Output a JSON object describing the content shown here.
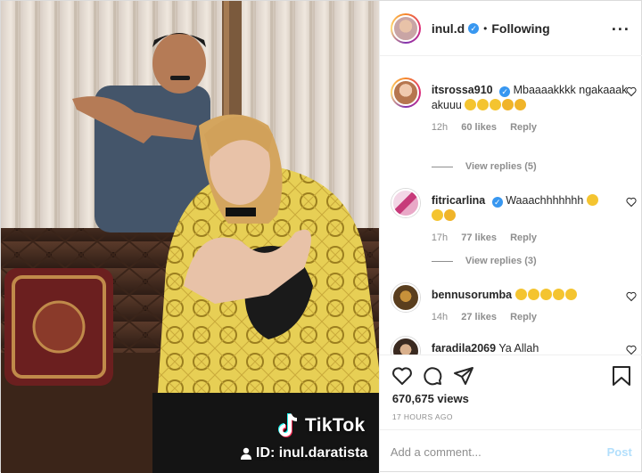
{
  "media": {
    "watermark": {
      "brand": "TikTok",
      "id_text": "ID: inul.daratista"
    }
  },
  "header": {
    "username": "inul.d",
    "separator": "•",
    "follow_status": "Following",
    "more": "···"
  },
  "comments": [
    {
      "username": "itsrossa910",
      "text": "Mbaaaakkkk ngakaaak akuuu",
      "emoji_count": 5,
      "time": "12h",
      "likes": "60 likes",
      "reply": "Reply",
      "replies": "View replies (5)"
    },
    {
      "username": "fitricarlina",
      "text": "Waaachhhhhhh",
      "emoji_count": 2,
      "time": "17h",
      "likes": "77 likes",
      "reply": "Reply",
      "replies": "View replies (3)"
    },
    {
      "username": "bennusorumba",
      "text": "",
      "emoji_count": 5,
      "time": "14h",
      "likes": "27 likes",
      "reply": "Reply"
    },
    {
      "username": "faradila2069",
      "text": "Ya Allah"
    }
  ],
  "stats": {
    "views": "670,675 views",
    "posted": "17 HOURS AGO"
  },
  "composer": {
    "placeholder": "Add a comment...",
    "post": "Post"
  },
  "colors": {
    "verified": "#3897f0",
    "post_disabled": "#b2dffc",
    "meta_gray": "#8e8e8e"
  },
  "icons": [
    "heart-icon",
    "comment-icon",
    "share-icon",
    "bookmark-icon",
    "verified-icon",
    "more-icon",
    "tiktok-icon",
    "person-icon"
  ]
}
